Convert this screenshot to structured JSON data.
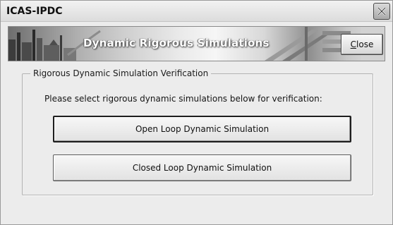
{
  "window": {
    "title": "ICAS-IPDC",
    "close_icon": "close-x-icon"
  },
  "banner": {
    "title": "Dynamic Rigorous Simulations",
    "image": "industrial-plant-illustration"
  },
  "toolbar": {
    "close_label": "Close",
    "close_mnemonic": "C",
    "close_rest": "lose"
  },
  "group": {
    "legend": "Rigorous Dynamic Simulation Verification",
    "instructions": "Please select rigorous dynamic simulations below for verification:",
    "buttons": [
      {
        "label": "Open Loop Dynamic Simulation",
        "focused": true
      },
      {
        "label": "Closed Loop Dynamic Simulation",
        "focused": false
      }
    ]
  }
}
